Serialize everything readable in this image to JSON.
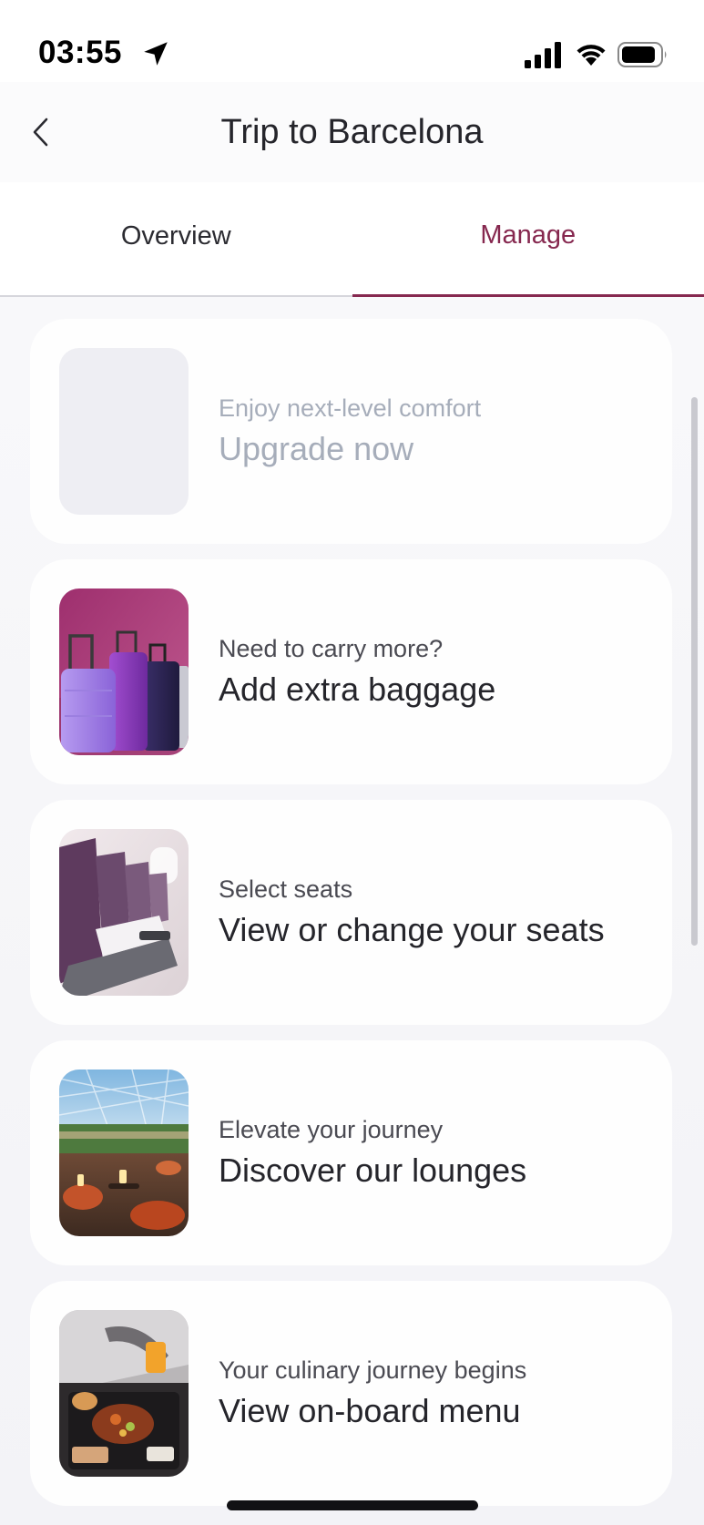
{
  "status_bar": {
    "time": "03:55"
  },
  "header": {
    "title": "Trip to Barcelona"
  },
  "tabs": [
    {
      "label": "Overview",
      "active": false
    },
    {
      "label": "Manage",
      "active": true
    }
  ],
  "accent_color": "#86284f",
  "cards": [
    {
      "subtitle": "Enjoy next-level comfort",
      "title": "Upgrade now",
      "image": "placeholder"
    },
    {
      "subtitle": "Need to carry more?",
      "title": "Add extra baggage",
      "image": "luggage"
    },
    {
      "subtitle": "Select seats",
      "title": "View or change your seats",
      "image": "airplane-seats"
    },
    {
      "subtitle": "Elevate your journey",
      "title": "Discover our lounges",
      "image": "lounge"
    },
    {
      "subtitle": "Your culinary journey begins",
      "title": "View on-board menu",
      "image": "inflight-meal"
    }
  ]
}
